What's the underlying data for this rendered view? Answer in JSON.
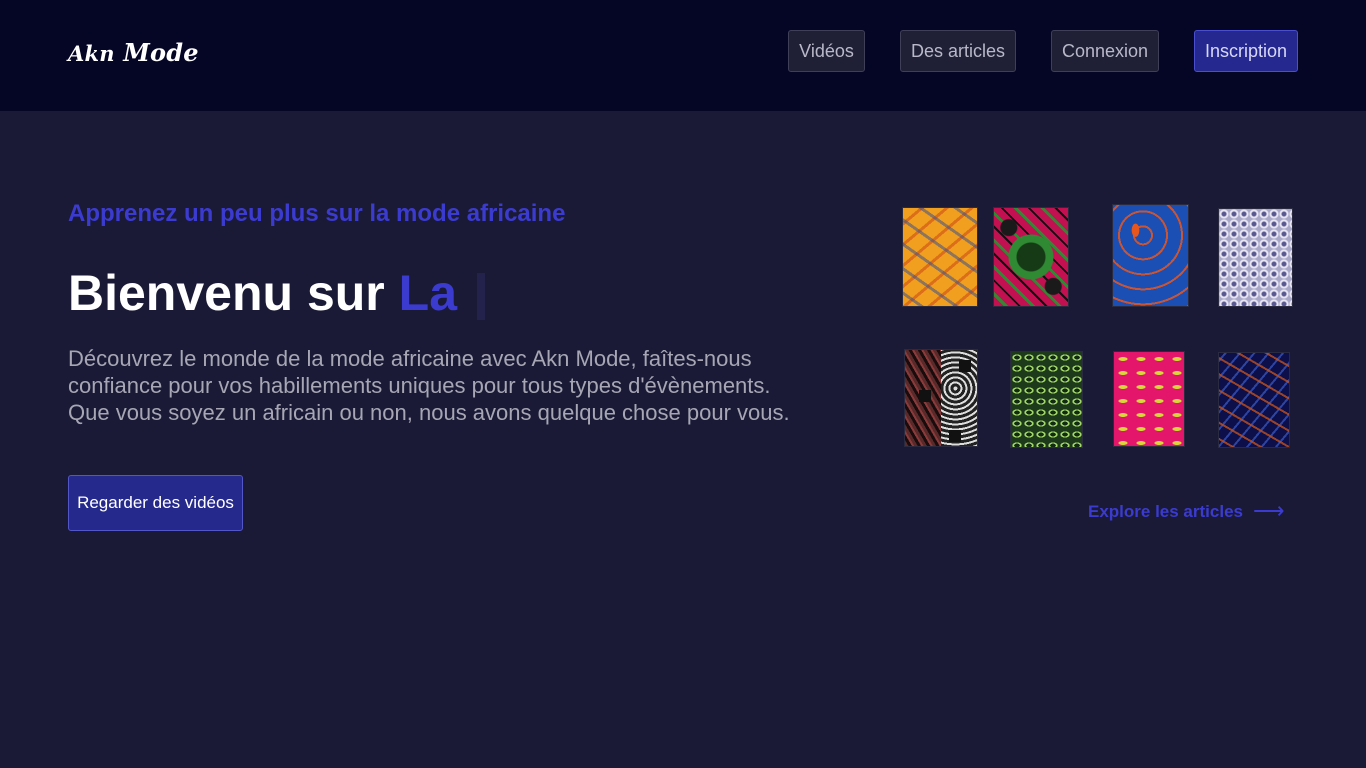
{
  "brand": {
    "name_part1": "Akn",
    "name_part2": "Mode"
  },
  "nav": {
    "videos": "Vidéos",
    "articles": "Des articles",
    "login": "Connexion",
    "signup": "Inscription"
  },
  "hero": {
    "eyebrow": "Apprenez un peu plus sur la mode africaine",
    "title_prefix": "Bienvenu sur",
    "title_typed": "La",
    "description": "Découvrez le monde de la mode africaine avec Akn Mode, faîtes-nous confiance pour vos habillements uniques pour tous types d'évènements. Que vous soyez un africain ou non, nous avons quelque chose pour vous.",
    "cta_label": "Regarder des vidéos"
  },
  "gallery": {
    "explore_label": "Explore les articles",
    "explore_arrow": "⟶"
  },
  "colors": {
    "page_bg": "#1a1a36",
    "header_bg": "#050625",
    "accent": "#3b3bd0",
    "primary_button": "#25298c"
  }
}
